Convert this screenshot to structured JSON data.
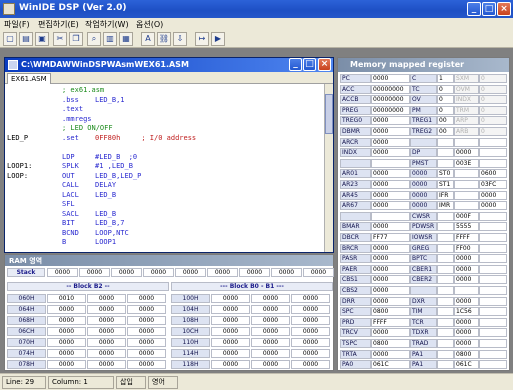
{
  "app": {
    "title": "WinIDE DSP (Ver 2.0)",
    "menu": [
      "파일(F)",
      "편집하기(E)",
      "작업하기(W)",
      "옵션(O)"
    ]
  },
  "editor": {
    "title": "C:\\WMDAWWinDSPWAsmWEX61.ASM",
    "tab": "EX61.ASM",
    "lines": [
      {
        "label": "",
        "op": "",
        "arg": "; ex61.asm",
        "type": "cmt"
      },
      {
        "label": "",
        "op": ".bss",
        "arg": "LED_B,1",
        "type": "kw"
      },
      {
        "label": "",
        "op": ".text",
        "arg": "",
        "type": "kw"
      },
      {
        "label": "",
        "op": ".mmregs",
        "arg": "",
        "type": "kw"
      },
      {
        "label": "",
        "op": "",
        "arg": "; LED ON/OFF",
        "type": "cmt"
      },
      {
        "label": "LED_P",
        "op": ".set",
        "arg": "0FF80h     ; I/0 address",
        "type": "mix"
      },
      {
        "label": "",
        "op": "",
        "arg": "",
        "type": "kw"
      },
      {
        "label": "",
        "op": "LDP",
        "arg": "#LED_B  ;0",
        "type": "kw"
      },
      {
        "label": "LOOP1:",
        "op": "SPLK",
        "arg": "#1 ,LED_B",
        "type": "kw"
      },
      {
        "label": "LOOP:",
        "op": "OUT",
        "arg": "LED_B,LED_P",
        "type": "kw"
      },
      {
        "label": "",
        "op": "CALL",
        "arg": "DELAY",
        "type": "kw"
      },
      {
        "label": "",
        "op": "LACL",
        "arg": "LED_B",
        "type": "kw"
      },
      {
        "label": "",
        "op": "SFL",
        "arg": "",
        "type": "kw"
      },
      {
        "label": "",
        "op": "SACL",
        "arg": "LED_B",
        "type": "kw"
      },
      {
        "label": "",
        "op": "BIT",
        "arg": "LED_B,7",
        "type": "kw"
      },
      {
        "label": "",
        "op": "BCND",
        "arg": "LOOP,NTC",
        "type": "kw"
      },
      {
        "label": "",
        "op": "B",
        "arg": "LOOP1",
        "type": "kw"
      }
    ]
  },
  "mmr": {
    "title": "Memory mapped register",
    "rows": [
      [
        "PC",
        "0000",
        "C",
        "1",
        "SXM",
        "0"
      ],
      [
        "ACC",
        "00000000",
        "TC",
        "0",
        "OVM",
        "0"
      ],
      [
        "ACCB",
        "00000000",
        "OV",
        "0",
        "INDX",
        "0"
      ],
      [
        "PREG",
        "00000000",
        "PM",
        "0",
        "TRM",
        "0"
      ],
      [
        "TREG0",
        "0000",
        "TREG1",
        "00",
        "ARP",
        "0"
      ],
      [
        "DBMR",
        "0000",
        "TREG2",
        "00",
        "ARB",
        "0"
      ],
      [
        "ARCR",
        "0000",
        "",
        "",
        "",
        ""
      ],
      [
        "INDX",
        "0000",
        "DP",
        "",
        "0000",
        ""
      ],
      [
        "",
        "",
        "PMST",
        "",
        "003E",
        ""
      ],
      [
        "AR01",
        "0000",
        "0000",
        "ST0",
        "",
        "0600"
      ],
      [
        "AR23",
        "0000",
        "0000",
        "ST1",
        "",
        "03FC"
      ],
      [
        "AR45",
        "0000",
        "0000",
        "IFR",
        "",
        "0000"
      ],
      [
        "AR67",
        "0000",
        "0000",
        "IMR",
        "",
        "0000"
      ],
      [
        "",
        "",
        "CWSR",
        "",
        "000F",
        ""
      ],
      [
        "BMAR",
        "0000",
        "PDWSR",
        "",
        "5555",
        ""
      ],
      [
        "DBCR",
        "FF77",
        "IOWSR",
        "",
        "FFFF",
        ""
      ],
      [
        "BRCR",
        "0000",
        "GREG",
        "",
        "FF00",
        ""
      ],
      [
        "PASR",
        "0000",
        "BPTC",
        "",
        "0000",
        ""
      ],
      [
        "PAER",
        "0000",
        "CBER1",
        "",
        "0000",
        ""
      ],
      [
        "CBS1",
        "0000",
        "CBER2",
        "",
        "0000",
        ""
      ],
      [
        "CBS2",
        "0000",
        "",
        "",
        "",
        ""
      ],
      [
        "DRR",
        "0000",
        "DXR",
        "",
        "0000",
        ""
      ],
      [
        "SPC",
        "0800",
        "TIM",
        "",
        "1C56",
        ""
      ],
      [
        "PRD",
        "FFFF",
        "TCR",
        "",
        "0000",
        ""
      ],
      [
        "TRCV",
        "0000",
        "TDXR",
        "",
        "0000",
        ""
      ],
      [
        "TSPC",
        "0800",
        "TRAD",
        "",
        "0000",
        ""
      ],
      [
        "TRTA",
        "0000",
        "PA1",
        "",
        "0800",
        ""
      ],
      [
        "PA0",
        "061C",
        "PA1",
        "",
        "061C",
        ""
      ]
    ]
  },
  "ram": {
    "title": "RAM 영역",
    "stack_label": "Stack",
    "stack_values": [
      "0000",
      "0000",
      "0000",
      "0000",
      "0000",
      "0000",
      "0000",
      "0000",
      "0000"
    ],
    "block_left": "-- Block B2 --",
    "block_right": "--- Block B0 - B1 ---",
    "rows": [
      [
        "060H",
        "0010",
        "0000",
        "0000",
        "100H",
        "0000",
        "0000",
        "0000"
      ],
      [
        "064H",
        "0000",
        "0000",
        "0000",
        "104H",
        "0000",
        "0000",
        "0000"
      ],
      [
        "068H",
        "0000",
        "0000",
        "0000",
        "108H",
        "0000",
        "0000",
        "0000"
      ],
      [
        "06CH",
        "0000",
        "0000",
        "0000",
        "10CH",
        "0000",
        "0000",
        "0000"
      ],
      [
        "070H",
        "0000",
        "0000",
        "0000",
        "110H",
        "0000",
        "0000",
        "0000"
      ],
      [
        "074H",
        "0000",
        "0000",
        "0000",
        "114H",
        "0000",
        "0000",
        "0000"
      ],
      [
        "078H",
        "0000",
        "0000",
        "0000",
        "118H",
        "0000",
        "0000",
        "0000"
      ]
    ]
  },
  "status": {
    "line": "Line: 29",
    "column": "Column: 1",
    "mode1": "삽입",
    "mode2": "영어"
  }
}
